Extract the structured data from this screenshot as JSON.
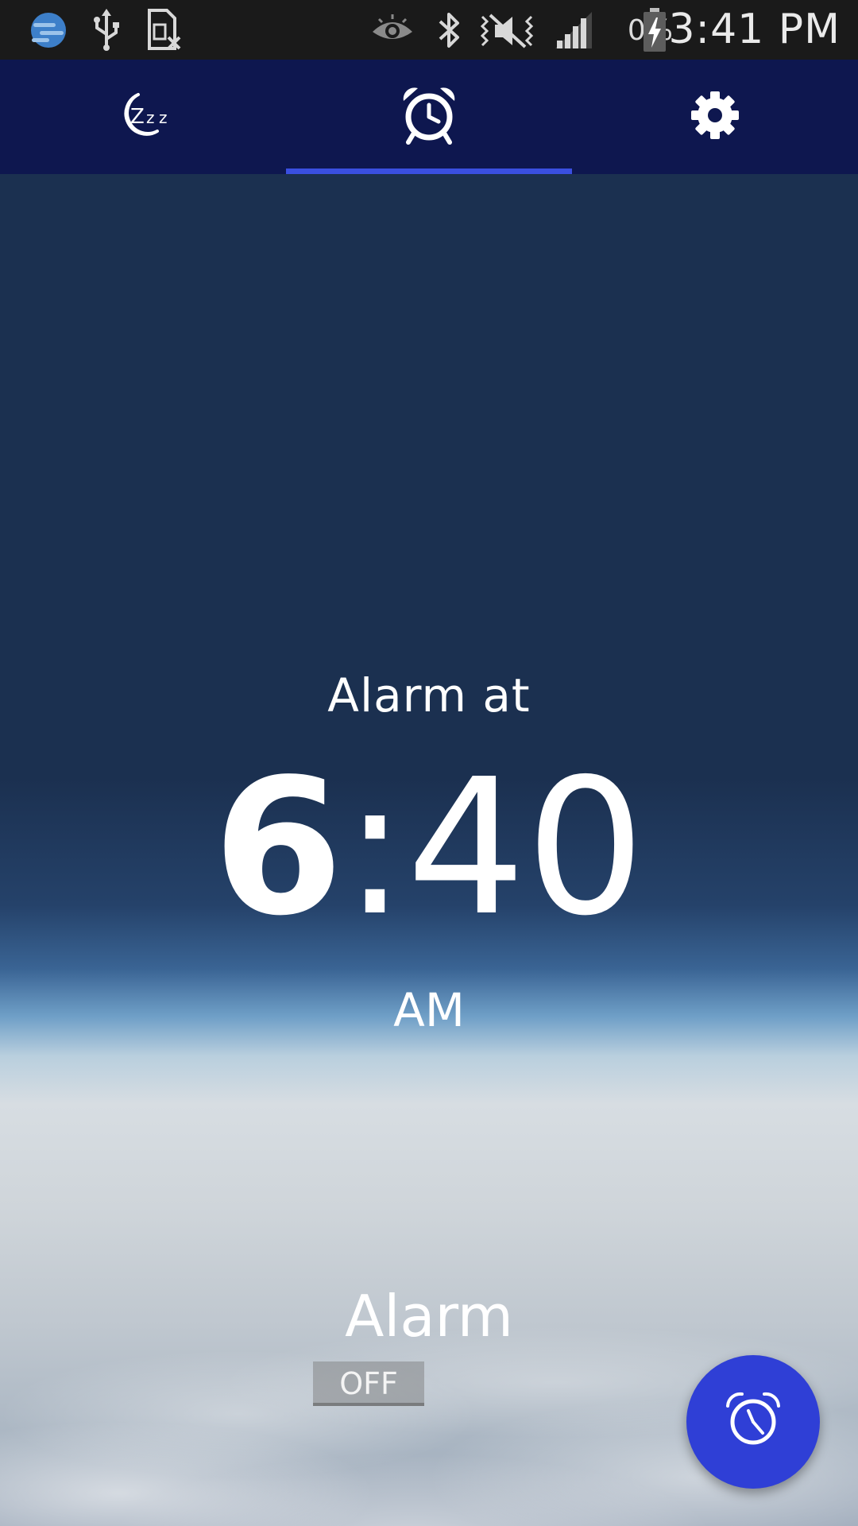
{
  "status_bar": {
    "time": "3:41 PM",
    "battery_percent": "0%",
    "icons": [
      "app-globe-icon",
      "usb-icon",
      "no-sim-icon",
      "eye-icon",
      "bluetooth-icon",
      "mute-icon",
      "signal-icon",
      "battery-charging-icon"
    ]
  },
  "tabs": [
    {
      "name": "sleep",
      "icon": "sleep-zzz-icon",
      "selected": false
    },
    {
      "name": "alarm",
      "icon": "alarm-clock-icon",
      "selected": true
    },
    {
      "name": "settings",
      "icon": "gear-icon",
      "selected": false
    }
  ],
  "alarm": {
    "heading": "Alarm at",
    "hour": "6",
    "separator": ":",
    "minutes": "40",
    "period": "AM",
    "label": "Alarm",
    "toggle_state": "OFF"
  },
  "fab": {
    "icon": "alarm-add-icon"
  },
  "colors": {
    "tab_bar": "#0e174f",
    "tab_indicator": "#3a4fe0",
    "fab": "#2f3fd6",
    "background_top": "#1b3050"
  }
}
